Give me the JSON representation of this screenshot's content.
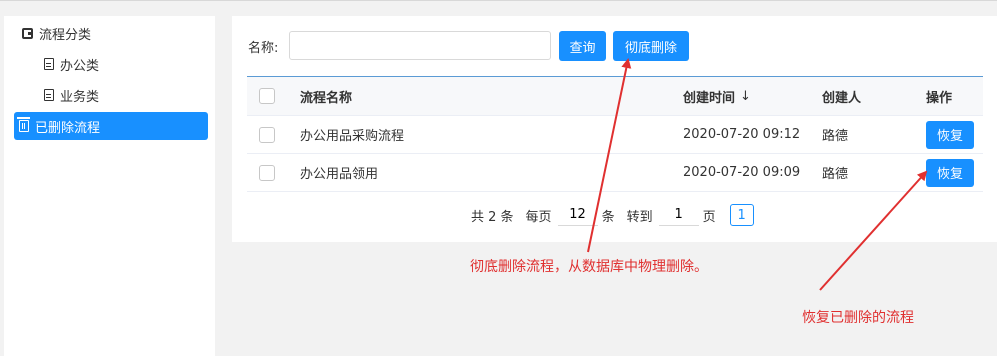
{
  "sidebar": {
    "category_label": "流程分类",
    "office_label": "办公类",
    "business_label": "业务类",
    "deleted_label": "已删除流程"
  },
  "search": {
    "label": "名称:",
    "value": "",
    "query_button": "查询",
    "purge_button": "彻底删除"
  },
  "table": {
    "headers": {
      "name": "流程名称",
      "time": "创建时间",
      "creator": "创建人",
      "operation": "操作"
    },
    "sort_glyph": "↓",
    "rows": [
      {
        "name": "办公用品采购流程",
        "time": "2020-07-20 09:12",
        "creator": "路德",
        "action": "恢复"
      },
      {
        "name": "办公用品领用",
        "time": "2020-07-20 09:09",
        "creator": "路德",
        "action": "恢复"
      }
    ]
  },
  "pager": {
    "total": "共 2 条",
    "per_page_label": "每页",
    "per_page_value": "12",
    "per_page_unit": "条",
    "goto_label": "转到",
    "goto_value": "1",
    "goto_unit": "页",
    "current_page": "1"
  },
  "annotations": {
    "purge_note": "彻底删除流程，从数据库中物理删除。",
    "restore_note": "恢复已删除的流程"
  },
  "colors": {
    "primary": "#1890ff",
    "annotation": "#e03030"
  }
}
